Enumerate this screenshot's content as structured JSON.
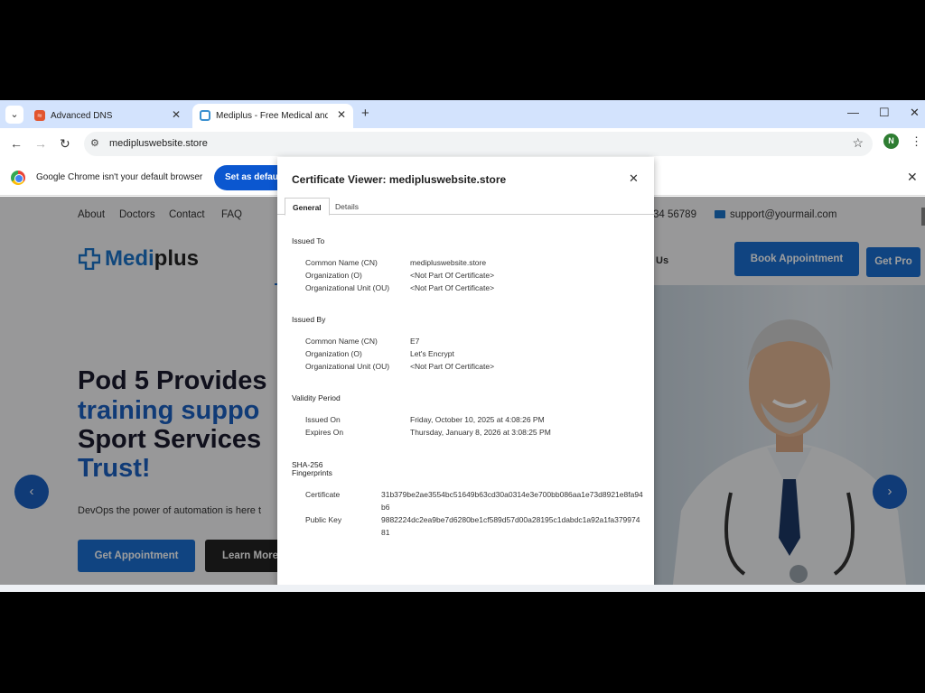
{
  "browser": {
    "tabs": [
      {
        "title": "Advanced DNS",
        "favicon": "dns-favicon",
        "active": false
      },
      {
        "title": "Mediplus - Free Medical and Doctor",
        "favicon": "mediplus-favicon",
        "active": true
      }
    ],
    "url": "medipluswebsite.store",
    "profile_initial": "N",
    "infobar": {
      "message": "Google Chrome isn't your default browser",
      "button_label": "Set as default"
    }
  },
  "site": {
    "topnav": [
      "About",
      "Doctors",
      "Contact",
      "FAQ"
    ],
    "phone_partial": "34 56789",
    "email": "support@yourmail.com",
    "logo": {
      "part1": "Medi",
      "part2": "plus"
    },
    "nav_partial": "Us",
    "book_button": "Book Appointment",
    "getpro_button": "Get Pro",
    "hero": {
      "line1": "Pod 5 Provides",
      "line2": "training suppo",
      "line3": "Sport Services",
      "line4": "Trust!",
      "subtitle": "DevOps the power of automation is here t",
      "cta_primary": "Get Appointment",
      "cta_secondary": "Learn More"
    },
    "accent_color": "#1a6fd0"
  },
  "certificate": {
    "title": "Certificate Viewer: medipluswebsite.store",
    "tabs": [
      "General",
      "Details"
    ],
    "active_tab": "General",
    "issued_to": {
      "heading": "Issued To",
      "fields": [
        {
          "label": "Common Name (CN)",
          "value": "medipluswebsite.store"
        },
        {
          "label": "Organization (O)",
          "value": "<Not Part Of Certificate>"
        },
        {
          "label": "Organizational Unit (OU)",
          "value": "<Not Part Of Certificate>"
        }
      ]
    },
    "issued_by": {
      "heading": "Issued By",
      "fields": [
        {
          "label": "Common Name (CN)",
          "value": "E7"
        },
        {
          "label": "Organization (O)",
          "value": "Let's Encrypt"
        },
        {
          "label": "Organizational Unit (OU)",
          "value": "<Not Part Of Certificate>"
        }
      ]
    },
    "validity": {
      "heading": "Validity Period",
      "fields": [
        {
          "label": "Issued On",
          "value": "Friday, October 10, 2025 at 4:08:26 PM"
        },
        {
          "label": "Expires On",
          "value": "Thursday, January 8, 2026 at 3:08:25 PM"
        }
      ]
    },
    "fingerprints": {
      "heading_line1": "SHA-256",
      "heading_line2": "Fingerprints",
      "fields": [
        {
          "label": "Certificate",
          "value": "31b379be2ae3554bc51649b63cd30a0314e3e700bb086aa1e73d8921e8fa94b6"
        },
        {
          "label": "Public Key",
          "value": "9882224dc2ea9be7d6280be1cf589d57d00a28195c1dabdc1a92a1fa37997481"
        }
      ]
    }
  }
}
